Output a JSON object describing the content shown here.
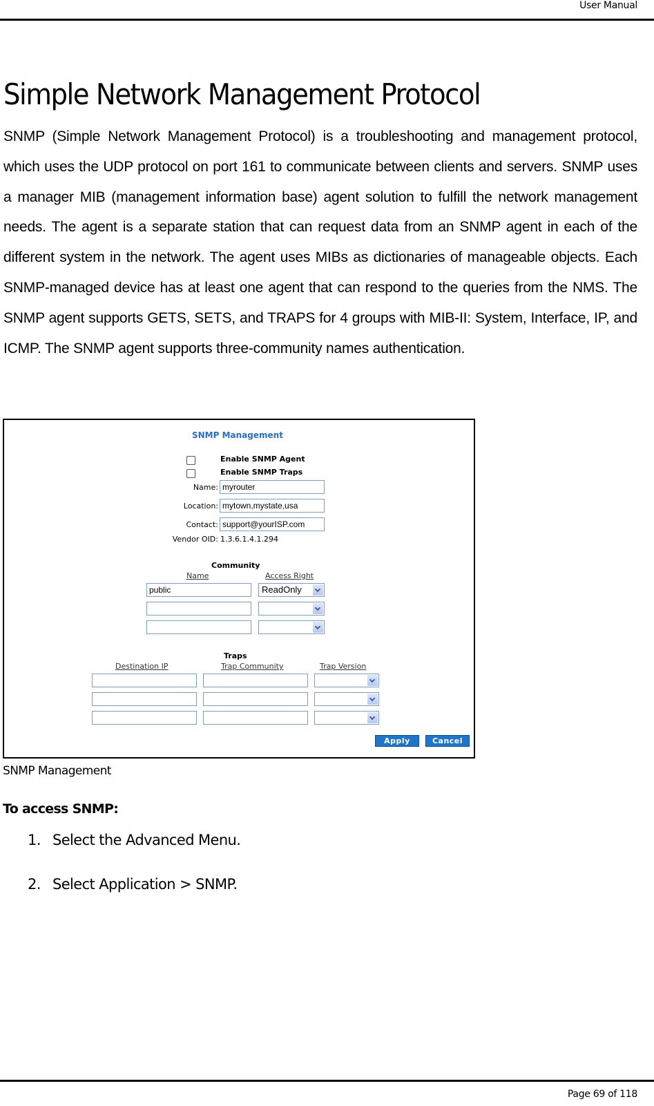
{
  "header": {
    "title": "User Manual"
  },
  "page_title": "Simple Network Management Protocol",
  "intro_paragraph": "SNMP (Simple Network Management Protocol) is a troubleshooting and management protocol, which uses the UDP protocol on port 161 to communicate between clients and servers. SNMP uses a manager MIB (management information base) agent solution to fulfill the network management needs. The agent is a separate station that can request data from an SNMP agent in each of the different system in the network. The agent uses MIBs as dictionaries of manageable objects. Each SNMP-managed device has at least one agent that can respond to the queries from the NMS. The SNMP agent supports GETS, SETS, and TRAPS for 4 groups with MIB-II: System, Interface, IP, and ICMP. The SNMP agent supports three-community names authentication.",
  "figure": {
    "title": "SNMP Management",
    "checkboxes": [
      {
        "label": "Enable SNMP Agent",
        "checked": false
      },
      {
        "label": "Enable SNMP Traps",
        "checked": false
      }
    ],
    "fields": {
      "name": {
        "label": "Name:",
        "value": "myrouter"
      },
      "location": {
        "label": "Location:",
        "value": "mytown,mystate,usa"
      },
      "contact": {
        "label": "Contact:",
        "value": "support@yourISP.com"
      },
      "vendor_oid": {
        "label": "Vendor OID:",
        "value": "1.3.6.1.4.1.294"
      }
    },
    "community": {
      "title": "Community",
      "col_name": "Name",
      "col_access": "Access Right",
      "rows": [
        {
          "name": "public",
          "access": "ReadOnly"
        },
        {
          "name": "",
          "access": ""
        },
        {
          "name": "",
          "access": ""
        }
      ]
    },
    "traps": {
      "title": "Traps",
      "col_ip": "Destination IP",
      "col_community": "Trap Community",
      "col_version": "Trap Version",
      "rows": [
        {
          "ip": "",
          "community": "",
          "version": ""
        },
        {
          "ip": "",
          "community": "",
          "version": ""
        },
        {
          "ip": "",
          "community": "",
          "version": ""
        }
      ]
    },
    "buttons": {
      "apply": "Apply",
      "cancel": "Cancel"
    },
    "colors": {
      "title": "#2a6ebb",
      "button": "#1f75c8"
    }
  },
  "caption": "SNMP Management",
  "procedure": {
    "heading": "To access SNMP:",
    "steps": [
      {
        "number": "1.",
        "prefix": "Select the ",
        "ui": "Advanced Menu",
        "suffix": "."
      },
      {
        "number": "2.",
        "prefix": "Select ",
        "ui": "Application > SNMP",
        "suffix": "."
      }
    ]
  },
  "footer": {
    "page_label": "Page 69  of 118"
  }
}
